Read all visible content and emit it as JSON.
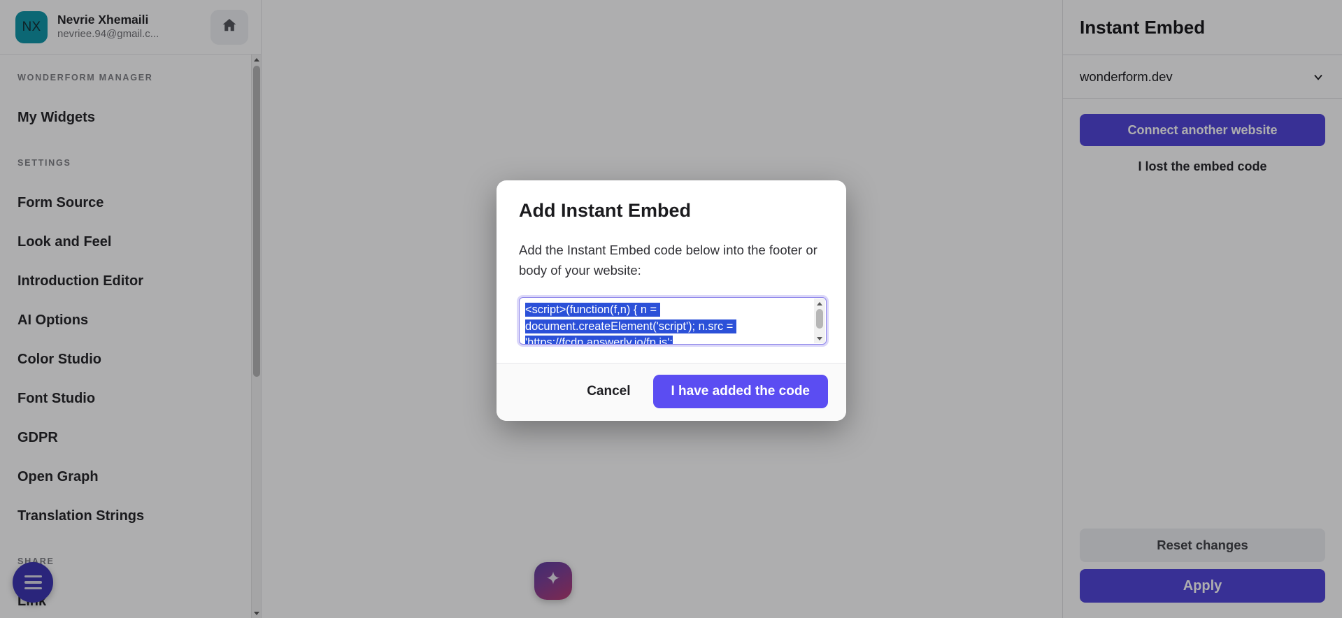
{
  "colors": {
    "accent": "#4d41d8",
    "dialog_primary": "#5b4df2",
    "avatar_bg": "#0a93a6",
    "fab_menu_bg": "#3730b0",
    "selection_bg": "#2b50d8",
    "scrim": "rgba(18,18,20,0.34)"
  },
  "sidebar": {
    "user": {
      "initials": "NX",
      "name": "Nevrie Xhemaili",
      "email": "nevriee.94@gmail.c...",
      "home_icon": "home-icon"
    },
    "groups": [
      {
        "label": "WONDERFORM MANAGER",
        "items": [
          {
            "label": "My Widgets"
          }
        ]
      },
      {
        "label": "SETTINGS",
        "items": [
          {
            "label": "Form Source"
          },
          {
            "label": "Look and Feel"
          },
          {
            "label": "Introduction Editor"
          },
          {
            "label": "AI Options"
          },
          {
            "label": "Color Studio"
          },
          {
            "label": "Font Studio"
          },
          {
            "label": "GDPR"
          },
          {
            "label": "Open Graph"
          },
          {
            "label": "Translation Strings"
          }
        ]
      },
      {
        "label": "SHARE",
        "items": [
          {
            "label": "Link"
          }
        ]
      }
    ],
    "fab_menu_icon": "hamburger-menu-icon",
    "fab_spark_icon": "sparkle-icon"
  },
  "right_panel": {
    "title": "Instant Embed",
    "website_select": {
      "value": "wonderform.dev",
      "chevron_icon": "chevron-down-icon"
    },
    "connect_button": "Connect another website",
    "lost_code_link": "I lost the embed code",
    "reset_button": "Reset changes",
    "apply_button": "Apply"
  },
  "dialog": {
    "title": "Add Instant Embed",
    "description": "Add the Instant Embed code below into the footer or body of your website:",
    "code": "<script>(function(f,n) { n = document.createElement('script'); n.src = 'https://fcdn.answerly.io/fp.js';",
    "code_selected": true,
    "cancel_button": "Cancel",
    "confirm_button": "I have added the code"
  }
}
